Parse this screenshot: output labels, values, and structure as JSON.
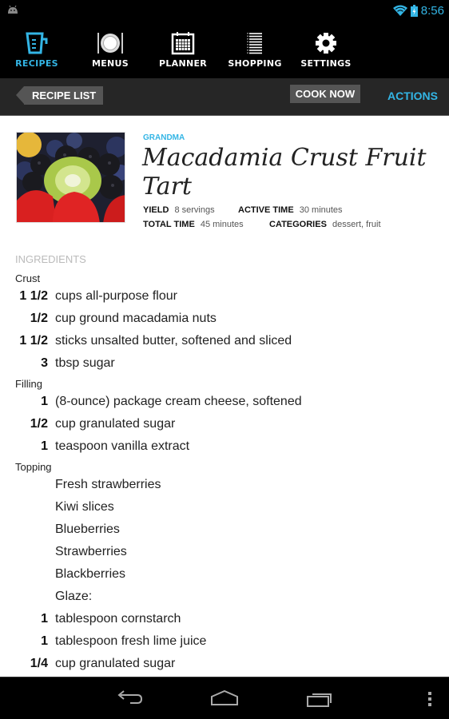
{
  "status_bar": {
    "time": "8:56",
    "icons": [
      "android-debug-icon",
      "wifi-icon",
      "battery-charging-icon"
    ]
  },
  "nav": {
    "items": [
      {
        "label": "RECIPES",
        "icon": "measuring-cup-icon",
        "active": true
      },
      {
        "label": "MENUS",
        "icon": "plate-icon",
        "active": false
      },
      {
        "label": "PLANNER",
        "icon": "calendar-icon",
        "active": false
      },
      {
        "label": "SHOPPING",
        "icon": "list-icon",
        "active": false
      },
      {
        "label": "SETTINGS",
        "icon": "gear-icon",
        "active": false
      }
    ]
  },
  "actionbar": {
    "back_label": "RECIPE LIST",
    "cook_label": "COOK NOW",
    "actions_label": "ACTIONS"
  },
  "recipe": {
    "source": "GRANDMA",
    "title": "Macadamia Crust Fruit Tart",
    "yield_label": "YIELD",
    "yield_value": "8 servings",
    "active_time_label": "ACTIVE TIME",
    "active_time_value": "30 minutes",
    "total_time_label": "TOTAL TIME",
    "total_time_value": "45 minutes",
    "categories_label": "CATEGORIES",
    "categories_value": "dessert, fruit",
    "photo_alt": "fruit tart photo"
  },
  "ingredients": {
    "heading": "INGREDIENTS",
    "groups": [
      {
        "label": "Crust",
        "items": [
          {
            "qty": "1 1/2",
            "text": "cups all-purpose flour"
          },
          {
            "qty": "1/2",
            "text": "cup ground macadamia nuts"
          },
          {
            "qty": "1 1/2",
            "text": "sticks unsalted butter, softened and sliced"
          },
          {
            "qty": "3",
            "text": "tbsp sugar"
          }
        ]
      },
      {
        "label": "Filling",
        "items": [
          {
            "qty": "1",
            "text": "(8-ounce) package cream cheese, softened"
          },
          {
            "qty": "1/2",
            "text": "cup granulated sugar"
          },
          {
            "qty": "1",
            "text": "teaspoon vanilla extract"
          }
        ]
      },
      {
        "label": "Topping",
        "items": [
          {
            "qty": "",
            "text": "Fresh strawberries"
          },
          {
            "qty": "",
            "text": "Kiwi slices"
          },
          {
            "qty": "",
            "text": "Blueberries"
          },
          {
            "qty": "",
            "text": "Strawberries"
          },
          {
            "qty": "",
            "text": "Blackberries"
          },
          {
            "qty": "",
            "text": "Glaze:"
          },
          {
            "qty": "1",
            "text": "tablespoon cornstarch"
          },
          {
            "qty": "1",
            "text": "tablespoon fresh lime juice"
          },
          {
            "qty": "1/4",
            "text": "cup granulated sugar"
          }
        ]
      }
    ]
  },
  "system_nav": {
    "buttons": [
      "back-icon",
      "home-icon",
      "recent-apps-icon",
      "overflow-menu-icon"
    ]
  },
  "colors": {
    "accent": "#33b5e5",
    "bar_bg": "#000000",
    "actionbar_bg": "#262626",
    "button_bg": "#555555"
  }
}
